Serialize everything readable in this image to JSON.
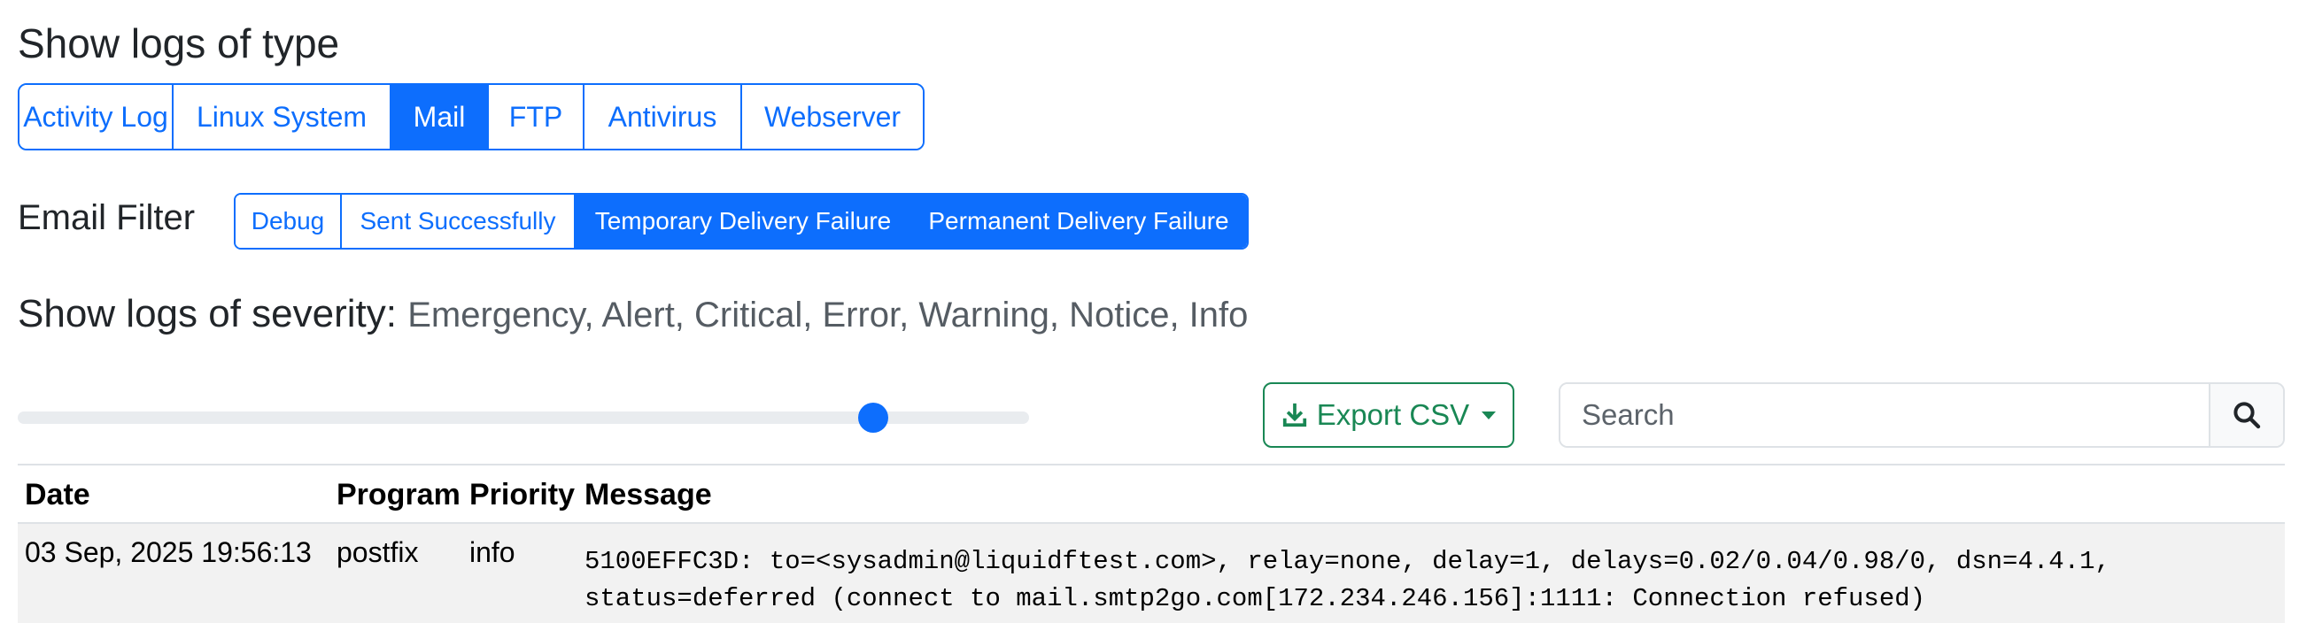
{
  "log_types": {
    "heading": "Show logs of type",
    "buttons": [
      {
        "label": "Activity Log",
        "active": false
      },
      {
        "label": "Linux System",
        "active": false
      },
      {
        "label": "Mail",
        "active": true
      },
      {
        "label": "FTP",
        "active": false
      },
      {
        "label": "Antivirus",
        "active": false
      },
      {
        "label": "Webserver",
        "active": false
      }
    ]
  },
  "email_filter": {
    "label": "Email Filter",
    "buttons": [
      {
        "label": "Debug",
        "active": false
      },
      {
        "label": "Sent Successfully",
        "active": false
      },
      {
        "label": "Temporary Delivery Failure",
        "active": true
      },
      {
        "label": "Permanent Delivery Failure",
        "active": true
      }
    ]
  },
  "severity": {
    "heading": "Show logs of severity:",
    "levels": "Emergency, Alert, Critical, Error, Warning, Notice, Info",
    "slider_value_fraction": 0.86
  },
  "toolbar": {
    "export_label": "Export CSV",
    "search_placeholder": "Search"
  },
  "table": {
    "columns": [
      "Date",
      "Program",
      "Priority",
      "Message"
    ],
    "rows": [
      {
        "date": "03 Sep, 2025 19:56:13",
        "program": "postfix",
        "priority": "info",
        "message_line1": "5100EFFC3D: to=<sysadmin@liquidftest.com>, relay=none, delay=1, delays=0.02/0.04/0.98/0, dsn=4.4.1,",
        "message_line2": "status=deferred (connect to mail.smtp2go.com[172.234.246.156]:1111: Connection refused)"
      }
    ]
  },
  "colors": {
    "primary": "#0d6efd",
    "success": "#198754",
    "row_bg": "#f2f2f2"
  }
}
